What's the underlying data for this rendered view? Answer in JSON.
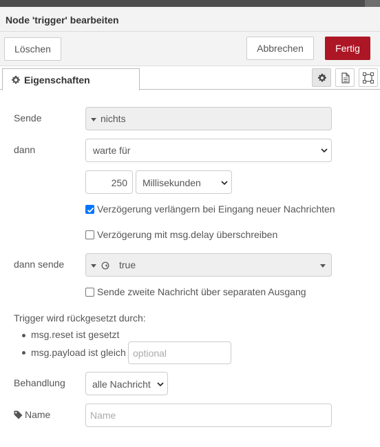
{
  "dialog": {
    "title": "Node 'trigger' bearbeiten",
    "buttons": {
      "delete": "Löschen",
      "cancel": "Abbrechen",
      "done": "Fertig"
    },
    "colors": {
      "primary": "#ad1625",
      "checkbox": "#0075ff"
    }
  },
  "tabs": {
    "properties": "Eigenschaften",
    "icons": [
      "gear-icon",
      "description-icon",
      "appearance-icon"
    ]
  },
  "form": {
    "send": {
      "label": "Sende",
      "value": "nichts"
    },
    "then": {
      "label": "dann",
      "value": "warte für"
    },
    "delay": {
      "value": "250",
      "unit": "Millisekunden"
    },
    "extend": {
      "label": "Verzögerung verlängern bei Eingang neuer Nachrichten",
      "checked": true
    },
    "override": {
      "label": "Verzögerung mit msg.delay überschreiben",
      "checked": false
    },
    "then_send": {
      "label": "dann sende",
      "value": "true"
    },
    "second_output": {
      "label": "Sende zweite Nachricht über separaten Ausgang",
      "checked": false
    },
    "reset": {
      "heading": "Trigger wird rückgesetzt durch:",
      "items": [
        "msg.reset ist gesetzt",
        "msg.payload ist gleich"
      ],
      "payload_placeholder": "optional"
    },
    "handling": {
      "label": "Behandlung",
      "value": "alle Nachricht"
    },
    "name": {
      "label": "Name",
      "placeholder": "Name",
      "value": ""
    }
  }
}
